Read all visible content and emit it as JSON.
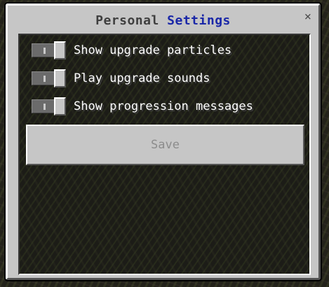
{
  "window": {
    "title_part1": "Personal",
    "title_part2": "Settings",
    "close_glyph": "×"
  },
  "colors": {
    "title_text": "#3f3f3f",
    "title_accent": "#1a27a8",
    "panel": "#c6c6c6",
    "content_bg": "#1c1c17",
    "label_text": "#ffffff",
    "disabled_text": "#8c8c8c"
  },
  "toggles": [
    {
      "label": "Show upgrade particles",
      "state": "off"
    },
    {
      "label": "Play upgrade sounds",
      "state": "off"
    },
    {
      "label": "Show progression messages",
      "state": "off"
    }
  ],
  "save_button": {
    "label": "Save",
    "enabled": false
  }
}
